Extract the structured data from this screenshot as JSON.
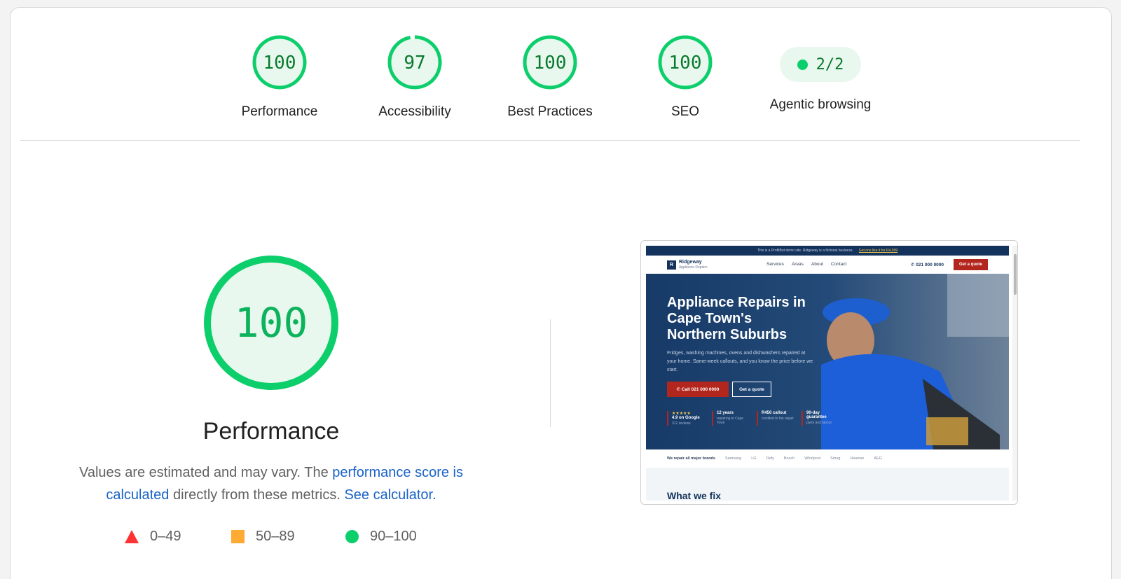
{
  "colors": {
    "pass": "#0cce6b",
    "pass_text": "#0a7a2f",
    "pass_bg": "#e9f8ee",
    "average": "#ffaa33",
    "fail": "#ff3333",
    "link": "#1a63c7"
  },
  "categories": [
    {
      "id": "performance",
      "label": "Performance",
      "score": 100
    },
    {
      "id": "accessibility",
      "label": "Accessibility",
      "score": 97
    },
    {
      "id": "best-practices",
      "label": "Best Practices",
      "score": 100
    },
    {
      "id": "seo",
      "label": "SEO",
      "score": 100
    }
  ],
  "agentic": {
    "label": "Agentic browsing",
    "value": "2/2"
  },
  "performance_section": {
    "score": 100,
    "title": "Performance",
    "desc_prefix": "Values are estimated and may vary. The ",
    "desc_link1": "performance score is calculated",
    "desc_middle": " directly from these metrics. ",
    "desc_link2": "See calculator.",
    "legend": [
      {
        "icon": "fail-triangle-icon",
        "range": "0–49"
      },
      {
        "icon": "average-square-icon",
        "range": "50–89"
      },
      {
        "icon": "pass-circle-icon",
        "range": "90–100"
      }
    ]
  },
  "preview": {
    "topbar_text": "This is a ProfitBot demo site. Ridgeway is a fictional business.",
    "topbar_link": "Get one like it for R4,999",
    "logo_letter": "R",
    "logo_name": "Ridgeway",
    "logo_sub": "Appliance Repairs",
    "nav_links": [
      "Services",
      "Areas",
      "About",
      "Contact"
    ],
    "nav_phone": "021 000 0000",
    "nav_cta": "Get a quote",
    "hero_title": "Appliance Repairs in Cape Town's Northern Suburbs",
    "hero_text": "Fridges, washing machines, ovens and dishwashers repaired at your home. Same-week callouts, and you know the price before we start.",
    "hero_btn_call": "Call 021 000 0000",
    "hero_btn_quote": "Get a quote",
    "stats": [
      {
        "top": "4.9 on Google",
        "sub": "312 reviews"
      },
      {
        "top": "12 years",
        "sub": "repairing in Cape Town"
      },
      {
        "top": "R450 callout",
        "sub": "credited to the repair"
      },
      {
        "top": "90-day guarantee",
        "sub": "parts and labour"
      }
    ],
    "brands_intro": "We repair all major brands",
    "brands": [
      "Samsung",
      "LG",
      "Defy",
      "Bosch",
      "Whirlpool",
      "Smeg",
      "Hisense",
      "AEG"
    ],
    "section_heading": "What we fix"
  }
}
